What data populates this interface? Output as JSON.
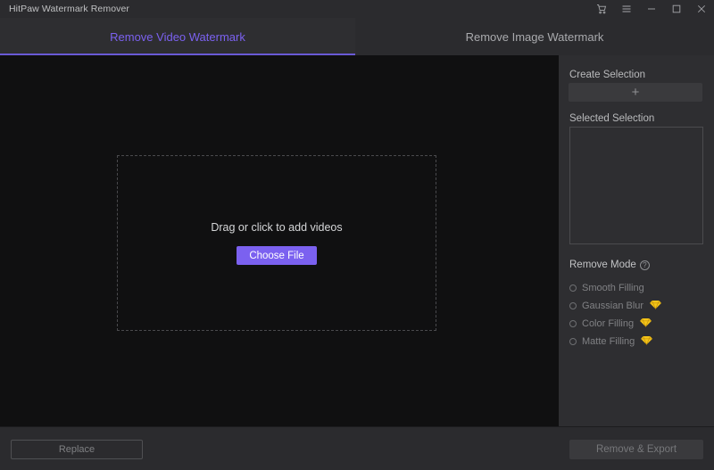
{
  "window": {
    "title": "HitPaw Watermark Remover",
    "controls": [
      {
        "name": "cart-icon",
        "label": "Cart"
      },
      {
        "name": "menu-icon",
        "label": "Menu"
      },
      {
        "name": "minimize-icon",
        "label": "Minimize"
      },
      {
        "name": "maximize-icon",
        "label": "Maximize"
      },
      {
        "name": "close-icon",
        "label": "Close"
      }
    ]
  },
  "tabs": [
    {
      "label": "Remove Video Watermark",
      "active": true
    },
    {
      "label": "Remove Image Watermark",
      "active": false
    }
  ],
  "canvas": {
    "drop_text": "Drag or click to add videos",
    "choose_file_label": "Choose File"
  },
  "sidebar": {
    "create_selection_label": "Create Selection",
    "create_selection_icon": "plus-icon",
    "create_selection_glyph": "+",
    "selected_selection_label": "Selected Selection",
    "remove_mode_label": "Remove Mode",
    "help_glyph": "?",
    "modes": [
      {
        "label": "Smooth Filling",
        "premium": false,
        "selected": false
      },
      {
        "label": "Gaussian Blur",
        "premium": true,
        "selected": false
      },
      {
        "label": "Color Filling",
        "premium": true,
        "selected": false
      },
      {
        "label": "Matte Filling",
        "premium": true,
        "selected": false
      }
    ]
  },
  "bottom": {
    "replace_label": "Replace",
    "remove_export_label": "Remove & Export"
  },
  "colors": {
    "accent_purple": "#7b61f0",
    "tab_underline": "#6a5ad6",
    "gem_gold": "#f5c518",
    "canvas_bg": "#101011",
    "panel_bg": "#2e2e31",
    "chrome_bg": "#2b2b2e"
  }
}
